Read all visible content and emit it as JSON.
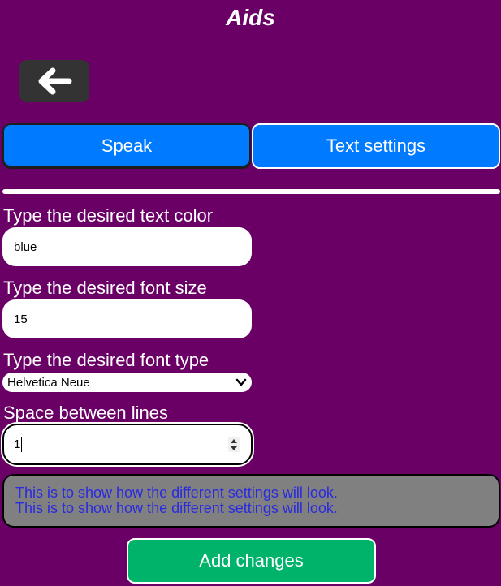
{
  "header": {
    "title": "Aids"
  },
  "nav": {
    "back_icon": "arrow-left-icon"
  },
  "tabs": [
    {
      "label": "Speak",
      "color": "#007bff"
    },
    {
      "label": "Text settings",
      "color": "#007bff"
    }
  ],
  "form": {
    "text_color": {
      "label": "Type the desired text color",
      "value": "blue"
    },
    "font_size": {
      "label": "Type the desired font size",
      "value": "15"
    },
    "font_type": {
      "label": "Type the desired font type",
      "selected": "Helvetica Neue"
    },
    "line_spacing": {
      "label": "Space between lines",
      "value": "1"
    }
  },
  "preview": {
    "lines": [
      "This is to show how the different settings will look.",
      "This is to show how the different settings will look."
    ],
    "text_color": "#2a2ae0",
    "background": "#808080"
  },
  "actions": {
    "add_label": "Add changes",
    "add_color": "#00b36b"
  },
  "theme": {
    "background": "#6a0066"
  }
}
